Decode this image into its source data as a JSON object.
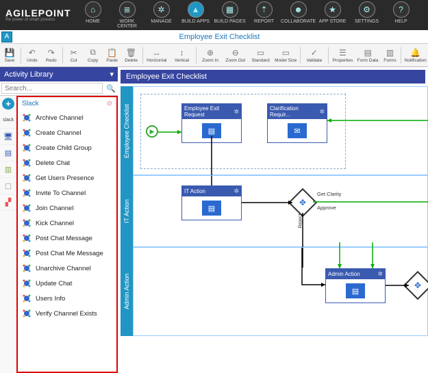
{
  "brand": {
    "name": "AGILEPOINT",
    "tagline": "the power of smart process"
  },
  "topnav": [
    {
      "label": "HOME",
      "icon": "⌂"
    },
    {
      "label": "WORK CENTER",
      "icon": "≣"
    },
    {
      "label": "MANAGE",
      "icon": "✲"
    },
    {
      "label": "BUILD APPS",
      "icon": "▲",
      "active": true
    },
    {
      "label": "BUILD PAGES",
      "icon": "▦"
    },
    {
      "label": "REPORT",
      "icon": "⇡"
    },
    {
      "label": "COLLABORATE",
      "icon": "☻"
    },
    {
      "label": "APP STORE",
      "icon": "★"
    },
    {
      "label": "SETTINGS",
      "icon": "⚙"
    },
    {
      "label": "HELP",
      "icon": "?"
    }
  ],
  "subheader": {
    "title": "Employee Exit Checklist"
  },
  "ribbon": [
    {
      "label": "Save",
      "icon": "💾"
    },
    {
      "label": "Undo",
      "icon": "↶"
    },
    {
      "label": "Redo",
      "icon": "↷"
    },
    {
      "label": "Cut",
      "icon": "✂"
    },
    {
      "label": "Copy",
      "icon": "⧉"
    },
    {
      "label": "Paste",
      "icon": "📋"
    },
    {
      "label": "Delete",
      "icon": "🗑"
    },
    {
      "label": "Horizontal",
      "icon": "↔"
    },
    {
      "label": "Vertical",
      "icon": "↕"
    },
    {
      "label": "Zoom In",
      "icon": "⊕"
    },
    {
      "label": "Zoom Out",
      "icon": "⊖"
    },
    {
      "label": "Standard",
      "icon": "▭"
    },
    {
      "label": "Model Size",
      "icon": "▭"
    },
    {
      "label": "Validate",
      "icon": "✓"
    },
    {
      "label": "Properties",
      "icon": "☰"
    },
    {
      "label": "Form Data",
      "icon": "▤"
    },
    {
      "label": "Forms",
      "icon": "▥"
    },
    {
      "label": "Notification",
      "icon": "🔔"
    }
  ],
  "library": {
    "title": "Activity Library",
    "search_placeholder": "Search...",
    "group": "Slack",
    "items": [
      "Archive Channel",
      "Create Channel",
      "Create Child Group",
      "Delete Chat",
      "Get Users Presence",
      "Invite To Channel",
      "Join Channel",
      "Kick Channel",
      "Post Chat Message",
      "Post Chat Me Message",
      "Unarchive Channel",
      "Update Chat",
      "Users Info",
      "Verify Channel Exists"
    ]
  },
  "canvas": {
    "title": "Employee Exit Checklist",
    "lanes": [
      {
        "label": "Employee Checklist"
      },
      {
        "label": "IT Action"
      },
      {
        "label": "Admin Action"
      }
    ],
    "activities": {
      "a1": "Employee Exit Request",
      "a2": "Clarification Requir...",
      "a3": "IT Action",
      "a4": "Admin Action"
    },
    "gateway": {
      "out1": "Get Clarity",
      "out2": "Approve",
      "side": "Reject"
    }
  }
}
